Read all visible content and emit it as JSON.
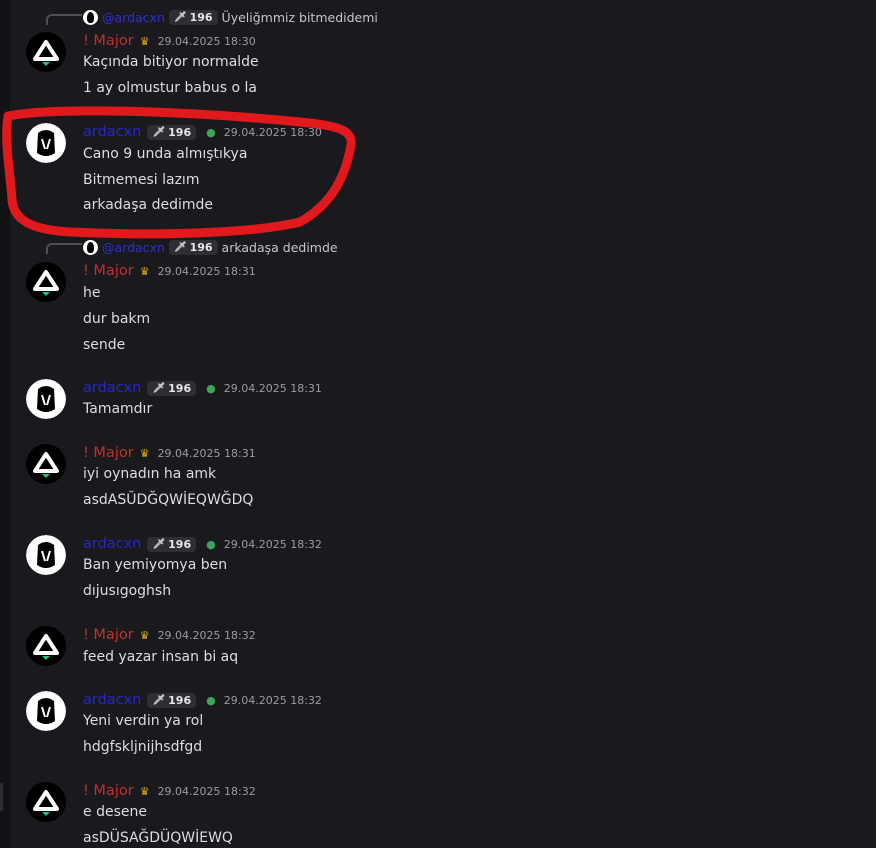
{
  "colors": {
    "background": "#1a1a1e",
    "major_name": "#c0312b",
    "arda_name": "#2626cc",
    "timestamp": "#9a9ca3",
    "highlight": "#e0191c"
  },
  "users": {
    "major": "! Major",
    "arda": "ardacxn",
    "reply_arda": "@ardacxn"
  },
  "badge": {
    "level": "196",
    "icon": "sword-icon"
  },
  "replies": [
    {
      "text": "Üyeliğmmiz bitmedidemi"
    },
    {
      "text": "arkadaşa dedimde"
    }
  ],
  "messages": [
    {
      "author": "! Major",
      "time": "29.04.2025 18:30",
      "lines": [
        "Kaçında bitiyor normalde",
        "1 ay olmustur babus o la"
      ]
    },
    {
      "author": "ardacxn",
      "time": "29.04.2025 18:30",
      "lines": [
        "Cano 9 unda almıştıkya",
        "Bitmemesi lazım",
        "arkadaşa dedimde"
      ]
    },
    {
      "author": "! Major",
      "time": "29.04.2025 18:31",
      "lines": [
        "he",
        "dur bakm",
        "sende"
      ]
    },
    {
      "author": "ardacxn",
      "time": "29.04.2025 18:31",
      "lines": [
        "Tamamdır"
      ]
    },
    {
      "author": "! Major",
      "time": "29.04.2025 18:31",
      "lines": [
        "iyi oynadın ha amk",
        "asdASŬDĞQWİEQWĞDQ"
      ]
    },
    {
      "author": "ardacxn",
      "time": "29.04.2025 18:32",
      "lines": [
        "Ban yemiyomya ben",
        "dıjusıgoghsh"
      ]
    },
    {
      "author": "! Major",
      "time": "29.04.2025 18:32",
      "lines": [
        "feed yazar insan bi aq"
      ]
    },
    {
      "author": "ardacxn",
      "time": "29.04.2025 18:32",
      "lines": [
        "Yeni verdin ya rol",
        "hdgfskljnijhsdfgd"
      ]
    },
    {
      "author": "! Major",
      "time": "29.04.2025 18:32",
      "lines": [
        "e desene",
        "asDÜSAĞDÜQWİEWQ"
      ]
    }
  ]
}
